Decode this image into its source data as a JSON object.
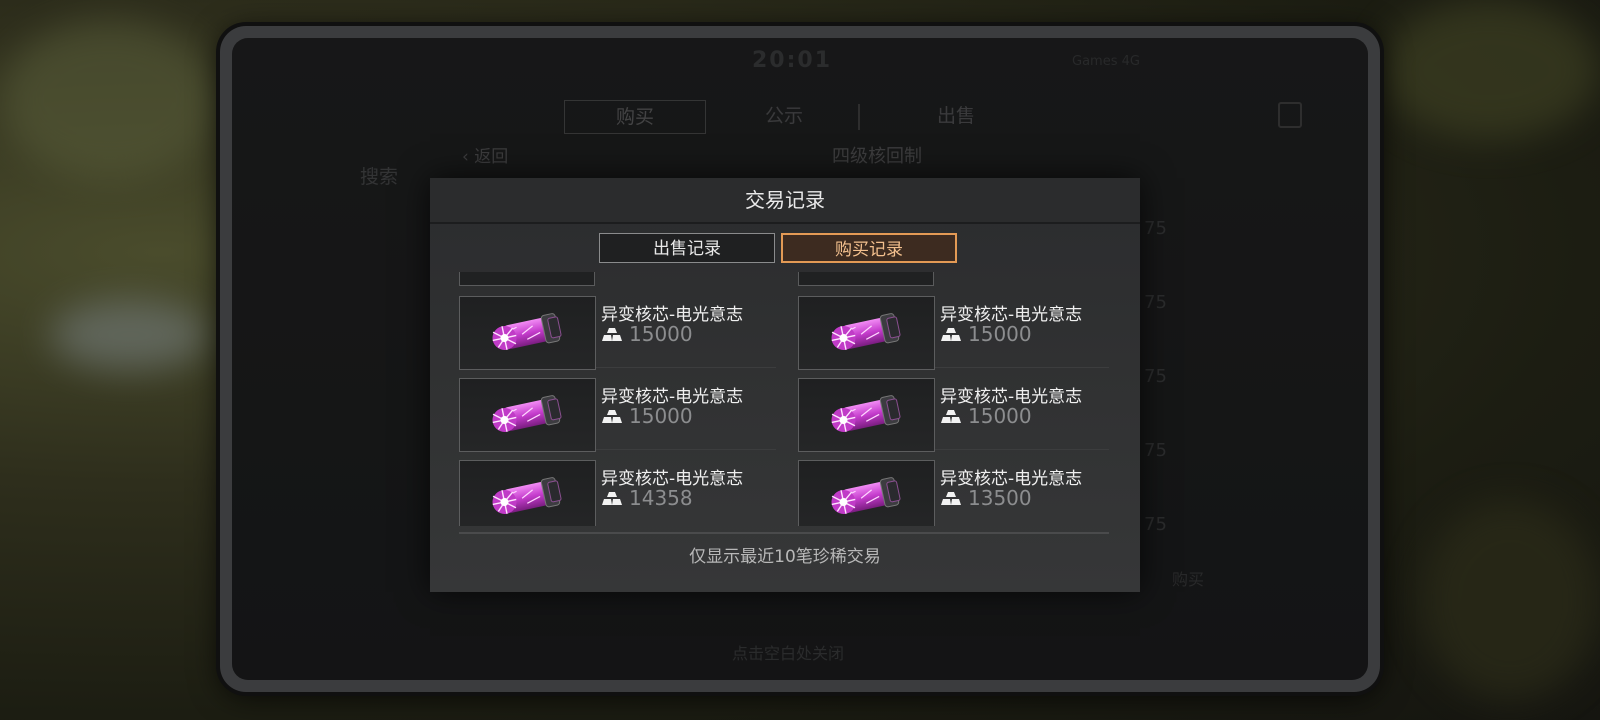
{
  "background": {
    "clock": "20:01",
    "network": "Games  4G",
    "tabs": [
      "购买",
      "公示",
      "出售"
    ],
    "back_label": "返回",
    "page_title": "四级核回制",
    "search_label": "搜索",
    "footer_hint": "点击空白处关闭",
    "buy_label": "购买",
    "side_numbers": [
      "75",
      "75",
      "75",
      "75",
      "75"
    ]
  },
  "modal": {
    "title": "交易记录",
    "tabs": {
      "sell": "出售记录",
      "buy": "购买记录",
      "active": "buy"
    },
    "footer": "仅显示最近10笔珍稀交易"
  },
  "records": [
    {
      "name": "异变核芯-电光意志",
      "price": "15000"
    },
    {
      "name": "异变核芯-电光意志",
      "price": "15000"
    },
    {
      "name": "异变核芯-电光意志",
      "price": "15000"
    },
    {
      "name": "异变核芯-电光意志",
      "price": "15000"
    },
    {
      "name": "异变核芯-电光意志",
      "price": "14358"
    },
    {
      "name": "异变核芯-电光意志",
      "price": "13500"
    }
  ],
  "icons": {
    "item": "mutant-core-icon",
    "currency": "gold-bar-icon"
  },
  "colors": {
    "active_tab_border": "#e39a55",
    "active_tab_text": "#f3c08e",
    "item_glow": "#d04ad6"
  }
}
